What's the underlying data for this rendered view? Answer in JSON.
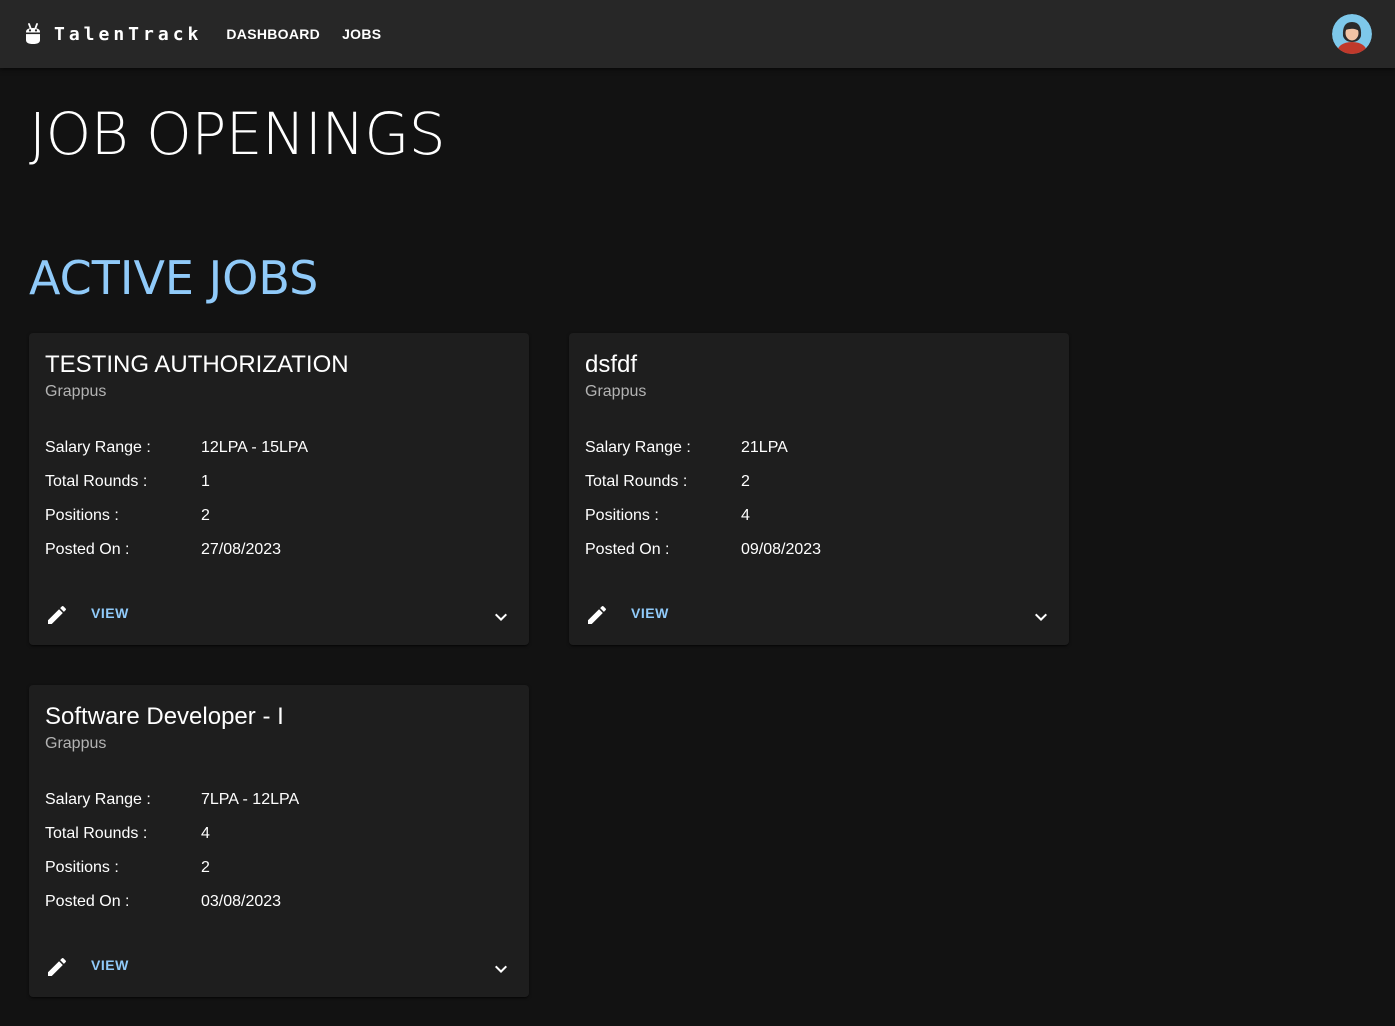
{
  "app": {
    "brand": "TalenTrack",
    "nav": [
      "DASHBOARD",
      "JOBS"
    ]
  },
  "page": {
    "title": "JOB OPENINGS",
    "section_title": "ACTIVE JOBS"
  },
  "labels": {
    "salary": "Salary Range :",
    "rounds": "Total Rounds :",
    "positions": "Positions :",
    "posted": "Posted On :",
    "view": "VIEW"
  },
  "jobs": [
    {
      "title": "TESTING AUTHORIZATION",
      "company": "Grappus",
      "salary": "12LPA - 15LPA",
      "rounds": "1",
      "positions": "2",
      "posted": "27/08/2023"
    },
    {
      "title": "dsfdf",
      "company": "Grappus",
      "salary": "21LPA",
      "rounds": "2",
      "positions": "4",
      "posted": "09/08/2023"
    },
    {
      "title": "Software Developer - I",
      "company": "Grappus",
      "salary": "7LPA - 12LPA",
      "rounds": "4",
      "positions": "2",
      "posted": "03/08/2023"
    }
  ],
  "icons": {
    "logo": "robot-icon",
    "avatar": "user-avatar",
    "edit": "pencil-icon",
    "expand": "chevron-down-icon"
  },
  "colors": {
    "background": "#121212",
    "appbar": "#272727",
    "card": "#1e1e1e",
    "accent": "#90caf9"
  }
}
